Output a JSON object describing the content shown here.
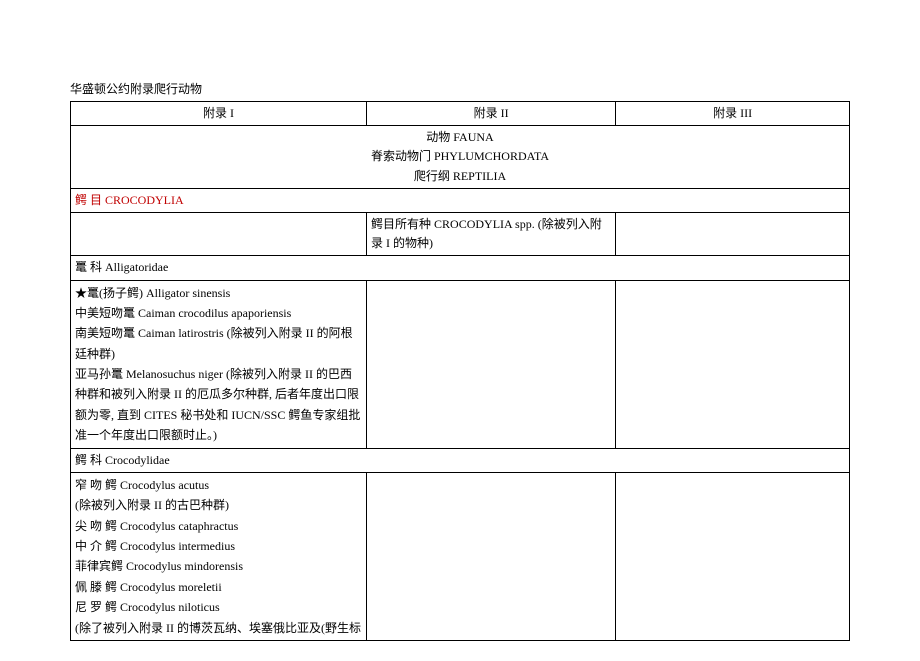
{
  "title": "华盛顿公约附录爬行动物",
  "headers": {
    "appendix1": "附录 I",
    "appendix2": "附录 II",
    "appendix3": "附录 III"
  },
  "taxonomy": {
    "kingdom": "动物 FAUNA",
    "phylum": "脊索动物门 PHYLUMCHORDATA",
    "class": "爬行纲 REPTILIA"
  },
  "order": {
    "label": "鳄 目 CROCODYLIA",
    "appendix2_note": "鳄目所有种 CROCODYLIA spp. (除被列入附录 I 的物种)"
  },
  "family1": {
    "label": "鼍 科 Alligatoridae",
    "appendix1_lines": [
      "★鼍(扬子鳄) Alligator sinensis",
      "中美短吻鼍 Caiman crocodilus apaporiensis",
      "南美短吻鼍 Caiman latirostris (除被列入附录 II 的阿根廷种群)",
      "亚马孙鼍 Melanosuchus niger (除被列入附录 II 的巴西种群和被列入附录 II 的厄瓜多尔种群, 后者年度出口限额为零, 直到 CITES 秘书处和 IUCN/SSC 鳄鱼专家组批准一个年度出口限额时止。)"
    ]
  },
  "family2": {
    "label": "鳄 科 Crocodylidae",
    "appendix1_lines": [
      "窄 吻 鳄 Crocodylus acutus",
      "(除被列入附录 II 的古巴种群)",
      "尖 吻 鳄 Crocodylus cataphractus",
      "中 介 鳄 Crocodylus intermedius",
      "菲律宾鳄 Crocodylus mindorensis",
      "佩 滕 鳄 Crocodylus moreletii",
      "尼 罗 鳄 Crocodylus niloticus",
      "(除了被列入附录 II 的博茨瓦纳、埃塞俄比亚及(野生标"
    ]
  }
}
